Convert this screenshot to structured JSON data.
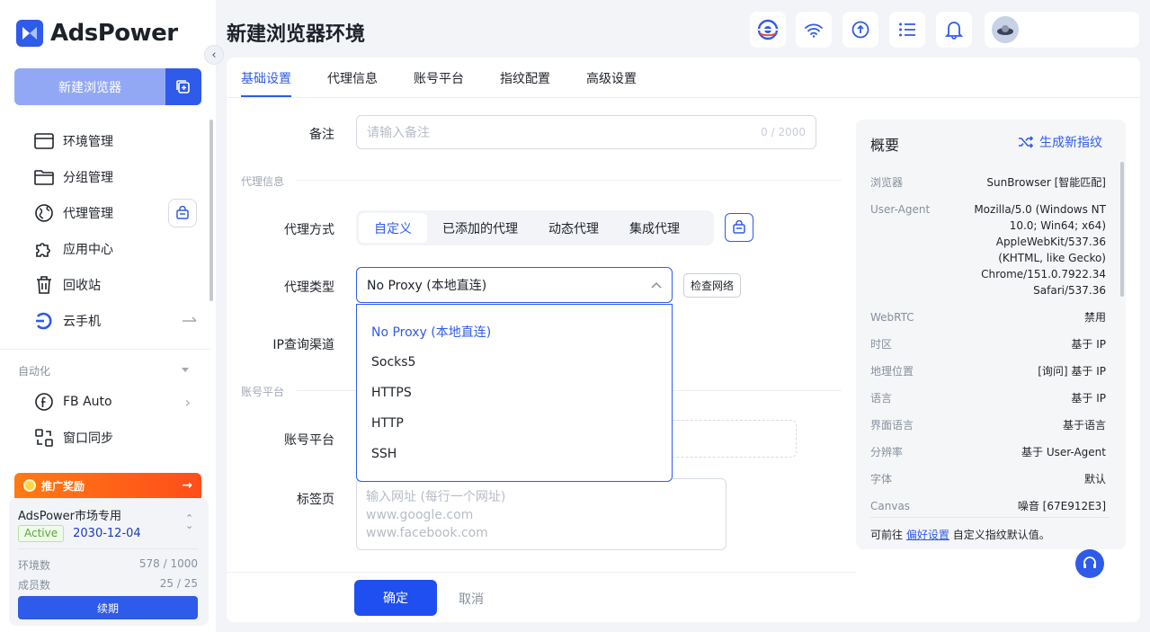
{
  "app": {
    "logo_text": "AdsPower"
  },
  "sidebar": {
    "new_browser": "新建浏览器",
    "items": [
      {
        "label": "环境管理",
        "icon": "browser-window-icon"
      },
      {
        "label": "分组管理",
        "icon": "folder-icon"
      },
      {
        "label": "代理管理",
        "icon": "proxy-globe-icon"
      },
      {
        "label": "应用中心",
        "icon": "puzzle-icon"
      },
      {
        "label": "回收站",
        "icon": "trash-icon"
      },
      {
        "label": "云手机",
        "icon": "cloud-phone-icon"
      }
    ],
    "automation_section": "自动化",
    "automation_items": [
      {
        "label": "FB Auto",
        "icon": "facebook-icon"
      },
      {
        "label": "窗口同步",
        "icon": "window-sync-icon"
      }
    ],
    "promo": {
      "label": "推广奖励",
      "arrow": "→"
    },
    "account": {
      "name": "AdsPower市场专用",
      "status": "Active",
      "expiry": "2030-12-04",
      "env_label": "环境数",
      "env_value": "578 / 1000",
      "member_label": "成员数",
      "member_value": "25 / 25",
      "renew": "续期"
    }
  },
  "header": {
    "title": "新建浏览器环境",
    "icons": [
      "sunbrowser-icon",
      "wifi-icon",
      "sync-icon",
      "list-icon",
      "bell-icon"
    ]
  },
  "tabs": [
    "基础设置",
    "代理信息",
    "账号平台",
    "指纹配置",
    "高级设置"
  ],
  "form": {
    "remark_label": "备注",
    "remark_placeholder": "请输入备注",
    "remark_count": "0 / 2000",
    "proxy_group": "代理信息",
    "proxy_mode_label": "代理方式",
    "proxy_modes": [
      "自定义",
      "已添加的代理",
      "动态代理",
      "集成代理"
    ],
    "proxy_type_label": "代理类型",
    "proxy_type_value": "No Proxy (本地直连)",
    "check_network": "检查网络",
    "proxy_type_options": [
      "No Proxy (本地直连)",
      "Socks5",
      "HTTPS",
      "HTTP",
      "SSH"
    ],
    "ip_channel_label": "IP查询渠道",
    "account_group": "账号平台",
    "account_platform_label": "账号平台",
    "tabs_label": "标签页",
    "tabs_placeholder_1": "输入网址 (每行一个网址)",
    "tabs_placeholder_2": "www.google.com",
    "tabs_placeholder_3": "www.facebook.com",
    "ok": "确定",
    "cancel": "取消"
  },
  "overview": {
    "title": "概要",
    "generate": "生成新指纹",
    "rows": [
      {
        "k": "浏览器",
        "v": "SunBrowser [智能匹配]"
      },
      {
        "k": "User-Agent",
        "v": "Mozilla/5.0 (Windows NT 10.0; Win64; x64) AppleWebKit/537.36 (KHTML, like Gecko) Chrome/151.0.7922.34 Safari/537.36"
      },
      {
        "k": "WebRTC",
        "v": "禁用"
      },
      {
        "k": "时区",
        "v": "基于 IP"
      },
      {
        "k": "地理位置",
        "v": "[询问] 基于 IP"
      },
      {
        "k": "语言",
        "v": "基于 IP"
      },
      {
        "k": "界面语言",
        "v": "基于语言"
      },
      {
        "k": "分辨率",
        "v": "基于 User-Agent"
      },
      {
        "k": "字体",
        "v": "默认"
      },
      {
        "k": "Canvas",
        "v": "噪音 [67E912E3]"
      }
    ],
    "foot_pre": "可前往",
    "foot_link": "偏好设置",
    "foot_post": "自定义指纹默认值。"
  },
  "colors": {
    "accent": "#2f5bea",
    "promo": "#ff5a1a",
    "active_green": "#52a83a"
  }
}
